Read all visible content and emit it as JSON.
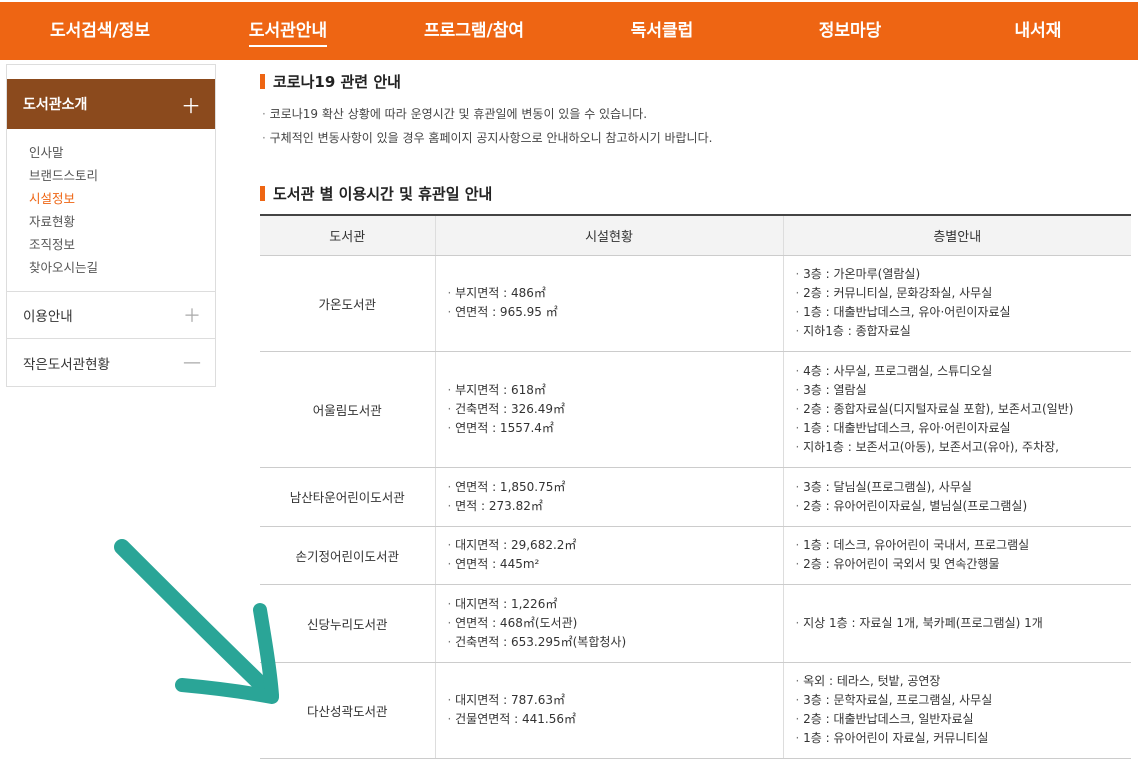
{
  "nav": {
    "items": [
      {
        "label": "도서검색/정보"
      },
      {
        "label": "도서관안내"
      },
      {
        "label": "프로그램/참여"
      },
      {
        "label": "독서클럽"
      },
      {
        "label": "정보마당"
      },
      {
        "label": "내서재"
      }
    ],
    "active_index": 1
  },
  "sidebar": {
    "section_title": "도서관소개",
    "sub_items": [
      "인사말",
      "브랜드스토리",
      "시설정보",
      "자료현황",
      "조직정보",
      "찾아오시는길"
    ],
    "active_sub": "시설정보",
    "rows": [
      {
        "label": "이용안내"
      },
      {
        "label": "작은도서관현황"
      }
    ]
  },
  "notice": {
    "title": "코로나19 관련 안내",
    "lines": [
      "코로나19 확산 상황에 따라 운영시간 및 휴관일에 변동이 있을 수 있습니다.",
      "구체적인 변동사항이 있을 경우 홈페이지 공지사항으로 안내하오니 참고하시기 바랍니다."
    ]
  },
  "hours": {
    "title": "도서관 별 이용시간 및 휴관일 안내",
    "columns": [
      "도서관",
      "시설현황",
      "층별안내"
    ],
    "rows": [
      {
        "name": "가온도서관",
        "facility": [
          "부지면적 : 486㎡",
          "연면적 : 965.95 ㎡"
        ],
        "floors": [
          "3층 : 가온마루(열람실)",
          "2층 : 커뮤니티실, 문화강좌실, 사무실",
          "1층 : 대출반납데스크, 유아·어린이자료실",
          "지하1층 : 종합자료실"
        ]
      },
      {
        "name": "어울림도서관",
        "facility": [
          "부지면적 : 618㎡",
          "건축면적 : 326.49㎡",
          "연면적 : 1557.4㎡"
        ],
        "floors": [
          "4층 : 사무실, 프로그램실, 스튜디오실",
          "3층 : 열람실",
          "2층 : 종합자료실(디지털자료실 포함), 보존서고(일반)",
          "1층 : 대출반납데스크, 유아·어린이자료실",
          "지하1층 : 보존서고(아동), 보존서고(유아), 주차장,"
        ]
      },
      {
        "name": "남산타운어린이도서관",
        "facility": [
          "연면적 : 1,850.75㎡",
          "면적 : 273.82㎡"
        ],
        "floors": [
          "3층 : 달님실(프로그램실), 사무실",
          "2층 : 유아어린이자료실, 별님실(프로그램실)"
        ]
      },
      {
        "name": "손기정어린이도서관",
        "facility": [
          "대지면적 : 29,682.2㎡",
          "연면적 : 445m²"
        ],
        "floors": [
          "1층 : 데스크, 유아어린이 국내서, 프로그램실",
          "2층 : 유아어린이 국외서 및 연속간행물"
        ]
      },
      {
        "name": "신당누리도서관",
        "facility": [
          "대지면적 : 1,226㎡",
          "연면적 : 468㎡(도서관)",
          "건축면적 : 653.295㎡(복합청사)"
        ],
        "floors": [
          "지상 1층 : 자료실 1개, 북카페(프로그램실) 1개"
        ]
      },
      {
        "name": "다산성곽도서관",
        "facility": [
          "대지면적 : 787.63㎡",
          "건물연면적 : 441.56㎡"
        ],
        "floors": [
          "옥외 : 테라스, 텃밭, 공연장",
          "3층 : 문학자료실, 프로그램실, 사무실",
          "2층 : 대출반납데스크, 일반자료실",
          "1층 : 유아어린이 자료실, 커뮤니티실"
        ]
      }
    ]
  },
  "colors": {
    "brand_orange": "#ee6513",
    "sidebar_brown": "#8b4a1d",
    "arrow_teal": "#2aa597"
  }
}
